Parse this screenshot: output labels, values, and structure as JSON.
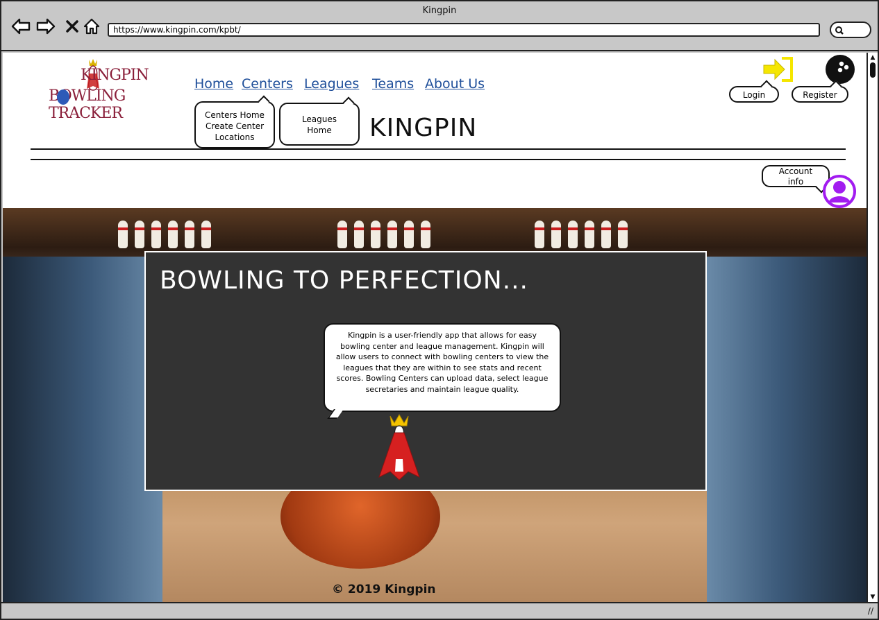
{
  "window": {
    "title": "Kingpin"
  },
  "browser": {
    "url": "https://www.kingpin.com/kpbt/"
  },
  "logo": {
    "line1": "KINGPIN",
    "line2": "BOWLING TRACKER"
  },
  "nav": [
    {
      "label": "Home"
    },
    {
      "label": "Centers"
    },
    {
      "label": "Leagues"
    },
    {
      "label": "Teams"
    },
    {
      "label": "About Us"
    }
  ],
  "centers_menu": {
    "items": [
      "Centers Home",
      "Create Center",
      "Locations"
    ]
  },
  "leagues_menu": {
    "items": [
      "Leagues",
      "Home"
    ]
  },
  "header": {
    "title": "KINGPIN"
  },
  "auth": {
    "login_label": "Login",
    "register_label": "Register"
  },
  "account": {
    "label_line1": "Account",
    "label_line2": "info"
  },
  "hero": {
    "title": "BOWLING TO PERFECTION...",
    "description": "Kingpin is a user-friendly app that allows for easy bowling center and league management. Kingpin will allow users to connect with bowling centers to view the leagues that they are within to see stats and recent scores. Bowling Centers can upload data, select league secretaries and maintain league quality."
  },
  "footer": {
    "text": "© 2019 Kingpin"
  },
  "colors": {
    "link": "#1f4f9a",
    "login_icon": "#f5e600",
    "avatar": "#a21cf0",
    "panel": "#333333"
  },
  "icons": [
    "back-icon",
    "forward-icon",
    "close-icon",
    "home-icon",
    "search-icon",
    "login-icon",
    "bowling-ball-icon",
    "user-avatar-icon"
  ]
}
